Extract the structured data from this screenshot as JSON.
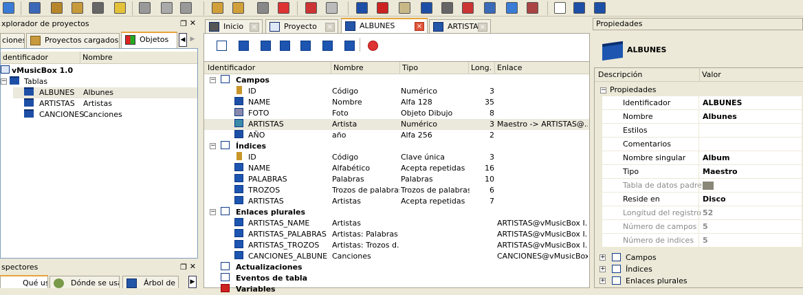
{
  "toolbar": {
    "icons": [
      "lightning-icon",
      "window-icon",
      "project-icon",
      "edit-icon",
      "save-icon",
      "warning-icon",
      "cut-icon",
      "copy-icon",
      "paste-icon",
      "new-folder-icon",
      "folder-icon",
      "delete-icon",
      "close-red-icon",
      "colors-icon",
      "magic-icon",
      "table-icon",
      "report-icon",
      "window2-icon",
      "gear-icon",
      "gear-red-icon",
      "class-icon",
      "molecule-icon",
      "tools-icon",
      "field-icon",
      "index-icon",
      "update-icon",
      "variable-icon"
    ]
  },
  "explorer": {
    "title": "xplorador de proyectos",
    "tabs": [
      "ciones",
      "Proyectos cargados",
      "Objetos"
    ],
    "columns": [
      "dentificador",
      "Nombre"
    ],
    "root": "vMusicBox 1.0",
    "group": "Tablas",
    "items": [
      {
        "id": "ALBUNES",
        "name": "Albunes"
      },
      {
        "id": "ARTISTAS",
        "name": "Artistas"
      },
      {
        "id": "CANCIONES",
        "name": "Canciones"
      }
    ]
  },
  "inspectors": {
    "title": "spectores",
    "tabs": [
      "Qué usa",
      "Dónde se usa",
      "Árbol de c"
    ]
  },
  "editor": {
    "tabs": [
      "Inicio",
      "Proyecto",
      "ALBUNES",
      "ARTISTAS"
    ],
    "columns": [
      "Identificador",
      "Nombre",
      "Tipo",
      "Long.",
      "Enlace"
    ],
    "sections": [
      {
        "label": "Campos",
        "rows": [
          {
            "id": "ID",
            "name": "Código",
            "type": "Numérico",
            "len": "3",
            "link": "",
            "icon": "key"
          },
          {
            "id": "NAME",
            "name": "Nombre",
            "type": "Alfa 128",
            "len": "35",
            "link": "",
            "icon": "alpha"
          },
          {
            "id": "FOTO",
            "name": "Foto",
            "type": "Objeto Dibujo",
            "len": "8",
            "link": "",
            "icon": "picture"
          },
          {
            "id": "ARTISTAS",
            "name": "Artista",
            "type": "Numérico",
            "len": "3",
            "link": "Maestro -> ARTISTAS@...",
            "icon": "link"
          },
          {
            "id": "AÑO",
            "name": "año",
            "type": "Alfa 256",
            "len": "2",
            "link": "",
            "icon": "alpha"
          }
        ]
      },
      {
        "label": "Índices",
        "rows": [
          {
            "id": "ID",
            "name": "Código",
            "type": "Clave única",
            "len": "3",
            "link": "",
            "icon": "key"
          },
          {
            "id": "NAME",
            "name": "Alfabético",
            "type": "Acepta repetidas",
            "len": "16",
            "link": "",
            "icon": "index"
          },
          {
            "id": "PALABRAS",
            "name": "Palabras",
            "type": "Palabras",
            "len": "10",
            "link": "",
            "icon": "index"
          },
          {
            "id": "TROZOS",
            "name": "Trozos de palabras",
            "type": "Trozos de palabras",
            "len": "6",
            "link": "",
            "icon": "index"
          },
          {
            "id": "ARTISTAS",
            "name": "Artistas",
            "type": "Acepta repetidas",
            "len": "7",
            "link": "",
            "icon": "index"
          }
        ]
      },
      {
        "label": "Enlaces plurales",
        "rows": [
          {
            "id": "ARTISTAS_NAME",
            "name": "Artistas",
            "type": "",
            "len": "",
            "link": "ARTISTAS@vMusicBox I...",
            "icon": "plural"
          },
          {
            "id": "ARTISTAS_PALABRAS",
            "name": "Artistas: Palabras",
            "type": "",
            "len": "",
            "link": "ARTISTAS@vMusicBox I...",
            "icon": "plural"
          },
          {
            "id": "ARTISTAS_TROZOS",
            "name": "Artistas: Trozos d...",
            "type": "",
            "len": "",
            "link": "ARTISTAS@vMusicBox I...",
            "icon": "plural"
          },
          {
            "id": "CANCIONES_ALBUNES",
            "name": "Canciones",
            "type": "",
            "len": "",
            "link": "CANCIONES@vMusicBox...",
            "icon": "plural"
          }
        ]
      },
      {
        "label": "Actualizaciones",
        "rows": []
      },
      {
        "label": "Eventos de tabla",
        "rows": []
      },
      {
        "label": "Variables",
        "rows": []
      }
    ]
  },
  "properties": {
    "title": "Propiedades",
    "object": "ALBUNES",
    "columns": [
      "Descripción",
      "Valor"
    ],
    "group": "Propiedades",
    "rows": [
      {
        "k": "Identificador",
        "v": "ALBUNES",
        "dim": false
      },
      {
        "k": "Nombre",
        "v": "Albunes",
        "dim": false
      },
      {
        "k": "Estilos",
        "v": "",
        "dim": false
      },
      {
        "k": "Comentarios",
        "v": "",
        "dim": false
      },
      {
        "k": "Nombre singular",
        "v": "Album",
        "dim": false
      },
      {
        "k": "Tipo",
        "v": "Maestro",
        "dim": false
      },
      {
        "k": "Tabla de datos padre",
        "v": "",
        "dim": true
      },
      {
        "k": "Reside en",
        "v": "Disco",
        "dim": false
      },
      {
        "k": "Longitud del registro",
        "v": "52",
        "dim": true
      },
      {
        "k": "Número de campos",
        "v": "5",
        "dim": true
      },
      {
        "k": "Número de indices",
        "v": "5",
        "dim": true
      }
    ],
    "collapsed": [
      "Campos",
      "Índices",
      "Enlaces plurales"
    ]
  }
}
